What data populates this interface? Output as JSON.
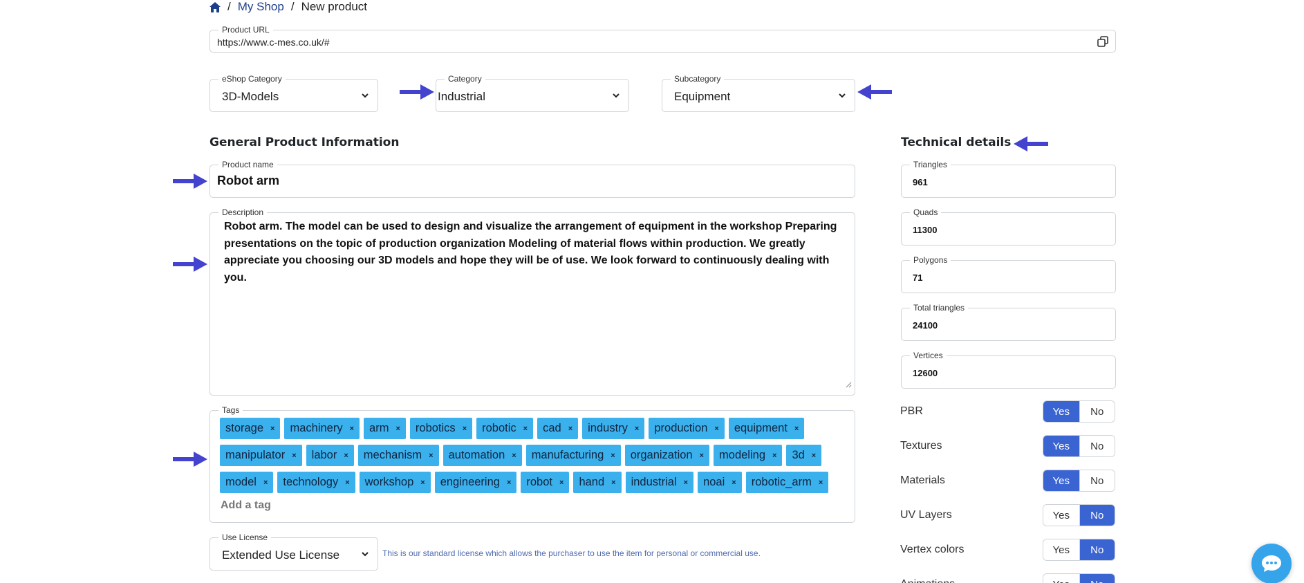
{
  "breadcrumb": {
    "home_icon": "home-icon",
    "shop": "My Shop",
    "current": "New product",
    "separator": "/"
  },
  "product_url": {
    "label": "Product URL",
    "value": "https://www.c-mes.co.uk/#",
    "copy_icon": "copy-icon"
  },
  "eshop_category": {
    "label": "eShop Category",
    "value": "3D-Models"
  },
  "category": {
    "label": "Category",
    "value": "Industrial"
  },
  "subcategory": {
    "label": "Subcategory",
    "value": "Equipment"
  },
  "general": {
    "title": "General Product Information",
    "product_name": {
      "label": "Product name",
      "value": "Robot arm"
    },
    "description": {
      "label": "Description",
      "value": "Robot arm. The model can be used to design and visualize the arrangement of equipment in the workshop Preparing presentations on the topic of production organization Modeling of material flows within production. We greatly appreciate you choosing our 3D models and hope they will be of use. We look forward to continuously dealing with you."
    },
    "tags": {
      "label": "Tags",
      "items": [
        "storage",
        "machinery",
        "arm",
        "robotics",
        "robotic",
        "cad",
        "industry",
        "production",
        "equipment",
        "manipulator",
        "labor",
        "mechanism",
        "automation",
        "manufacturing",
        "organization",
        "modeling",
        "3d",
        "model",
        "technology",
        "workshop",
        "engineering",
        "robot",
        "hand",
        "industrial",
        "noai",
        "robotic_arm"
      ],
      "remove_symbol": "×",
      "add_placeholder": "Add a tag"
    },
    "license": {
      "label": "Use License",
      "value": "Extended Use License",
      "hint": "This is our standard license which allows the purchaser to use the item for personal or commercial use."
    }
  },
  "technical": {
    "title": "Technical details",
    "fields": [
      {
        "label": "Triangles",
        "value": "961"
      },
      {
        "label": "Quads",
        "value": "11300"
      },
      {
        "label": "Polygons",
        "value": "71"
      },
      {
        "label": "Total triangles",
        "value": "24100"
      },
      {
        "label": "Vertices",
        "value": "12600"
      }
    ],
    "toggles": [
      {
        "label": "PBR",
        "yes": "Yes",
        "no": "No",
        "selected": "yes"
      },
      {
        "label": "Textures",
        "yes": "Yes",
        "no": "No",
        "selected": "yes"
      },
      {
        "label": "Materials",
        "yes": "Yes",
        "no": "No",
        "selected": "yes"
      },
      {
        "label": "UV Layers",
        "yes": "Yes",
        "no": "No",
        "selected": "no"
      },
      {
        "label": "Vertex colors",
        "yes": "Yes",
        "no": "No",
        "selected": "no"
      },
      {
        "label": "Animations",
        "yes": "Yes",
        "no": "No",
        "selected": "no"
      }
    ]
  },
  "colors": {
    "accent": "#3a64d2",
    "tag": "#3ab0ec",
    "arrow": "#4343cf",
    "chat": "#36a4eb"
  },
  "chat_button": {
    "icon": "chat-icon"
  }
}
